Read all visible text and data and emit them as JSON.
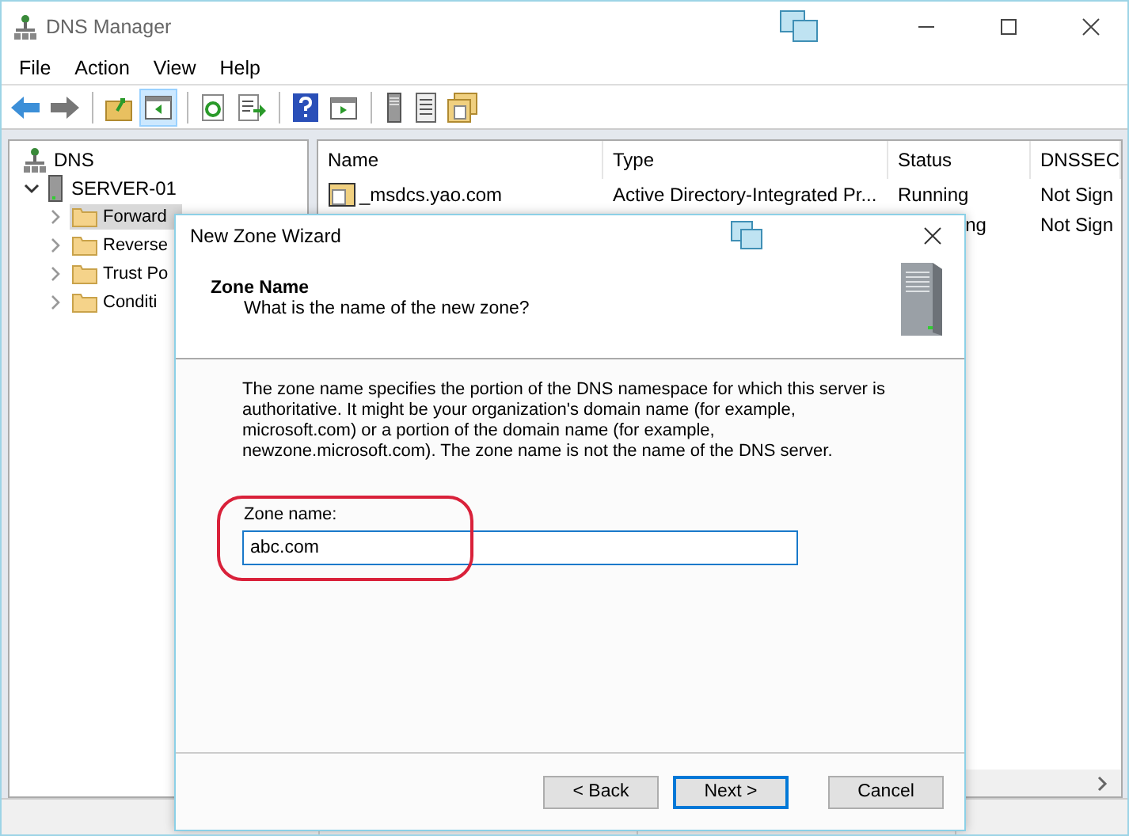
{
  "window": {
    "title": "DNS Manager"
  },
  "menu": [
    "File",
    "Action",
    "View",
    "Help"
  ],
  "tree": {
    "label": "DNS",
    "children": [
      {
        "label": "SERVER-01",
        "expanded": true,
        "children": [
          {
            "label": "Forward",
            "selected": true
          },
          {
            "label": "Reverse",
            "selected": false
          },
          {
            "label": "Trust Po",
            "selected": false
          },
          {
            "label": "Conditi",
            "selected": false
          }
        ]
      }
    ]
  },
  "table": {
    "columns": [
      "Name",
      "Type",
      "Status",
      "DNSSEC"
    ],
    "rows": [
      {
        "name": "_msdcs.yao.com",
        "type": "Active Directory-Integrated Pr...",
        "status": "Running",
        "dnssec": "Not Sign"
      },
      {
        "status": "ng",
        "dnssec": "Not Sign"
      }
    ]
  },
  "dialog": {
    "title": "New Zone Wizard",
    "heading": "Zone Name",
    "subheading": "What is the name of the new zone?",
    "description": "The zone name specifies the portion of the DNS namespace for which this server is authoritative. It might be your organization's domain name (for example,  microsoft.com) or a portion of the domain name (for example, newzone.microsoft.com). The zone name is not the name of the DNS server.",
    "field": {
      "label": "Zone name:",
      "value": "abc.com"
    },
    "buttons": [
      {
        "label": "< Back",
        "default": false
      },
      {
        "label": "Next >",
        "default": true
      },
      {
        "label": "Cancel",
        "default": false
      }
    ]
  }
}
